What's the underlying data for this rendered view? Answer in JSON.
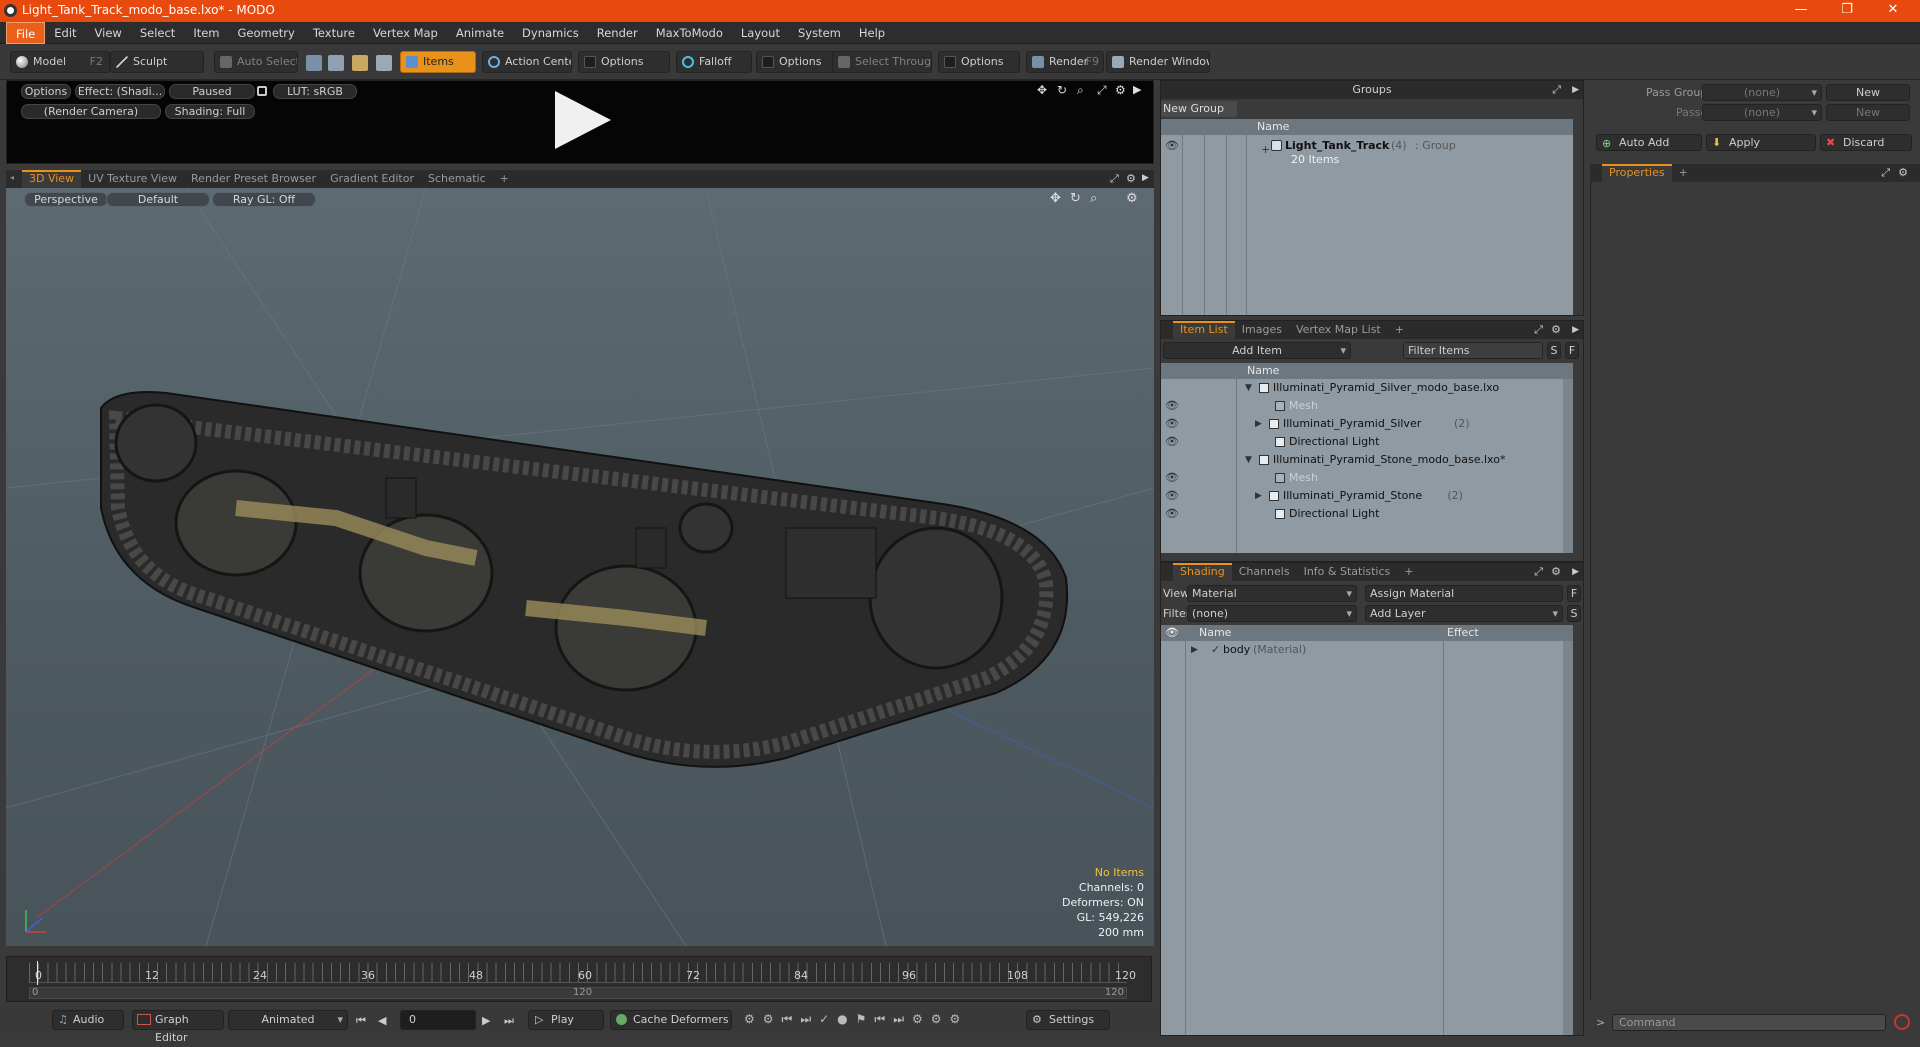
{
  "window": {
    "title": "Light_Tank_Track_modo_base.lxo* - MODO",
    "min": "—",
    "max": "❐",
    "close": "✕"
  },
  "menu": [
    "File",
    "Edit",
    "View",
    "Select",
    "Item",
    "Geometry",
    "Texture",
    "Vertex Map",
    "Animate",
    "Dynamics",
    "Render",
    "MaxToModo",
    "Layout",
    "System",
    "Help"
  ],
  "toolbar": {
    "model": "Model",
    "model_key": "F2",
    "sculpt": "Sculpt",
    "auto_select": "Auto Select",
    "items": "Items",
    "action_center": "Action Center",
    "options1": "Options",
    "falloff": "Falloff",
    "options2": "Options",
    "select_through": "Select Through",
    "options3": "Options",
    "render": "Render",
    "render_key": "F9",
    "render_window": "Render Window"
  },
  "preview": {
    "options": "Options",
    "effect": "Effect: (Shadi...",
    "paused": "Paused",
    "lut": "LUT: sRGB",
    "camera": "(Render Camera)",
    "shading": "Shading: Full"
  },
  "view_tabs": [
    "3D View",
    "UV Texture View",
    "Render Preset Browser",
    "Gradient Editor",
    "Schematic",
    "+"
  ],
  "viewport": {
    "perspective": "Perspective",
    "default": "Default",
    "raygl": "Ray GL: Off",
    "stats": {
      "no_items": "No Items",
      "channels": "Channels: 0",
      "deformers": "Deformers: ON",
      "gl": "GL: 549,226",
      "scale": "200 mm"
    }
  },
  "timeline": {
    "ticks": [
      "0",
      "12",
      "24",
      "36",
      "48",
      "60",
      "72",
      "84",
      "96",
      "108",
      "120"
    ],
    "start": "0",
    "mid": "120",
    "end": "120"
  },
  "bottombar": {
    "audio": "Audio",
    "graph_editor": "Graph Editor",
    "animated": "Animated",
    "frame": "0",
    "play": "Play",
    "cache": "Cache Deformers",
    "settings": "Settings"
  },
  "groups": {
    "title": "Groups",
    "new_group": "New Group",
    "col_name": "Name",
    "item_name": "Light_Tank_Track",
    "item_count": "(4)",
    "item_type": ": Group",
    "item_sub": "20 Items"
  },
  "itemlist": {
    "tabs": [
      "Item List",
      "Images",
      "Vertex Map List",
      "+"
    ],
    "add_item": "Add Item",
    "filter": "Filter Items",
    "s": "S",
    "f": "F",
    "col_name": "Name",
    "rows": [
      {
        "label": "Illuminati_Pyramid_Silver_modo_base.lxo",
        "indent": 0,
        "muted": false,
        "count": ""
      },
      {
        "label": "Mesh",
        "indent": 2,
        "muted": true,
        "count": ""
      },
      {
        "label": "Illuminati_Pyramid_Silver",
        "indent": 1,
        "muted": false,
        "count": "(2)"
      },
      {
        "label": "Directional Light",
        "indent": 2,
        "muted": false,
        "count": ""
      },
      {
        "label": "Illuminati_Pyramid_Stone_modo_base.lxo*",
        "indent": 0,
        "muted": false,
        "count": ""
      },
      {
        "label": "Mesh",
        "indent": 2,
        "muted": true,
        "count": ""
      },
      {
        "label": "Illuminati_Pyramid_Stone",
        "indent": 1,
        "muted": false,
        "count": "(2)"
      },
      {
        "label": "Directional Light",
        "indent": 2,
        "muted": false,
        "count": ""
      }
    ]
  },
  "shading": {
    "tabs": [
      "Shading",
      "Channels",
      "Info & Statistics",
      "+"
    ],
    "view_label": "View",
    "view_value": "Material",
    "assign": "Assign Material",
    "f": "F",
    "filter_label": "Filter",
    "filter_value": "(none)",
    "add_layer": "Add Layer",
    "s": "S",
    "col_name": "Name",
    "col_effect": "Effect",
    "row_name": "body",
    "row_type": "(Material)"
  },
  "passes": {
    "pass_groups": "Pass Groups",
    "passes": "Passes",
    "none1": "(none)",
    "none2": "(none)",
    "new1": "New",
    "new2": "New",
    "auto_add": "Auto Add",
    "apply": "Apply",
    "discard": "Discard",
    "properties": "Properties",
    "plus": "+",
    "command": "Command"
  },
  "colors": {
    "accent": "#e8921c",
    "titlebar": "#e8490f",
    "list_bg": "#8f9aa3"
  }
}
